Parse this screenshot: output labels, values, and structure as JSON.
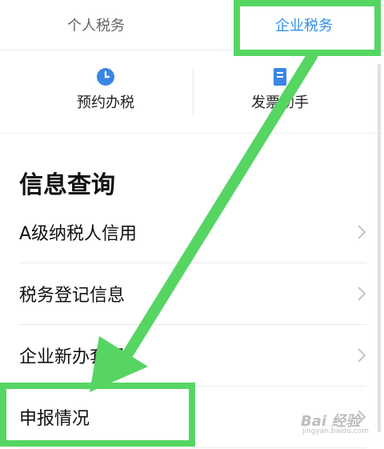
{
  "tabs": {
    "personal": "个人税务",
    "enterprise": "企业税务"
  },
  "quick_actions": [
    {
      "label": "预约办税",
      "icon": "clock-icon"
    },
    {
      "label": "发票助手",
      "icon": "invoice-icon"
    }
  ],
  "section": {
    "title": "信息查询"
  },
  "list_items": [
    {
      "label": "A级纳税人信用"
    },
    {
      "label": "税务登记信息"
    },
    {
      "label": "企业新办套餐"
    },
    {
      "label": "申报情况"
    }
  ],
  "watermark": {
    "text": "Bai 经验",
    "sub": "jingyan.baidu.com"
  },
  "colors": {
    "accent_blue": "#2f8fe9",
    "highlight_green": "#56d563"
  }
}
